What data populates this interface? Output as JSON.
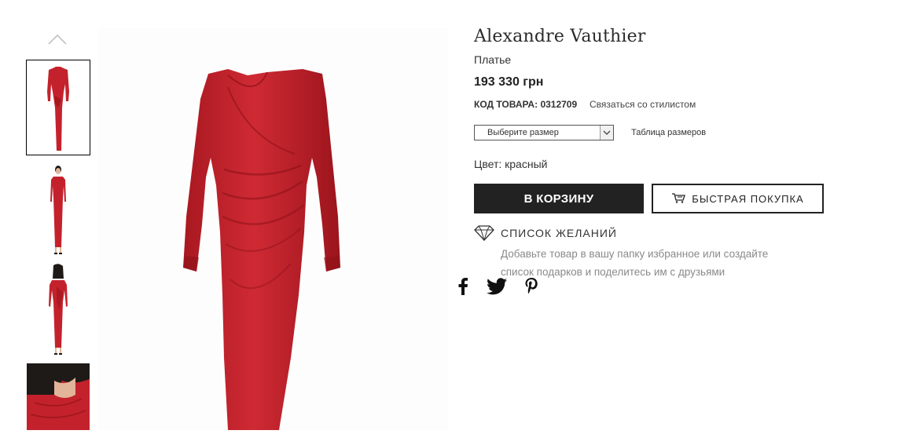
{
  "gallery": {
    "thumbnails": [
      {
        "alt": "front-full"
      },
      {
        "alt": "model-front"
      },
      {
        "alt": "model-back"
      },
      {
        "alt": "model-detail"
      }
    ],
    "colors": {
      "dress": "#c3222c",
      "dress_dark": "#8f1219",
      "skin": "#e2b49a",
      "hair": "#1e1a18"
    }
  },
  "product": {
    "brand": "Alexandre Vauthier",
    "type": "Платье",
    "price": "193 330 грн",
    "code_label": "КОД ТОВАРА:",
    "code_value": "0312709",
    "contact_stylist": "Связаться со стилистом",
    "size_placeholder": "Выберите размер",
    "size_table": "Таблица размеров",
    "color": "Цвет: красный"
  },
  "actions": {
    "add_to_cart": "В КОРЗИНУ",
    "quick_buy": "БЫСТРАЯ ПОКУПКА"
  },
  "wishlist": {
    "label": "СПИСОК ЖЕЛАНИЙ",
    "description": "Добавьте товар в вашу папку избранное или создайте список подарков и поделитесь им с друзьями"
  },
  "social": {
    "icons": [
      "facebook-icon",
      "twitter-icon",
      "pinterest-icon"
    ]
  }
}
